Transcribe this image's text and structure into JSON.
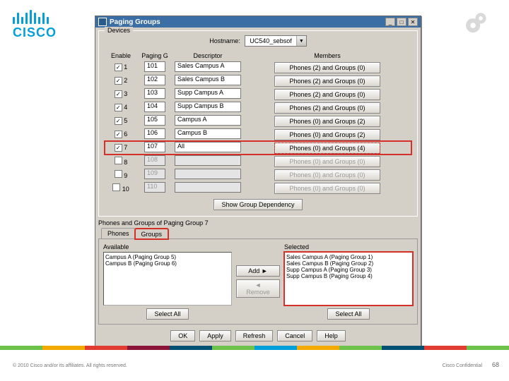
{
  "logo_text": "CISCO",
  "window": {
    "title": "Paging Groups",
    "devices_legend": "Devices",
    "hostname_label": "Hostname:",
    "hostname_value": "UC540_sebsof",
    "columns": {
      "enable": "Enable",
      "pgroup": "Paging G",
      "descriptor": "Descriptor",
      "members": "Members"
    },
    "rows": [
      {
        "enabled": true,
        "idx": "1",
        "code": "101",
        "desc": "Sales Campus A",
        "members": "Phones (2) and Groups (0)",
        "row_hl": "",
        "members_hl": ""
      },
      {
        "enabled": true,
        "idx": "2",
        "code": "102",
        "desc": "Sales Campus B",
        "members": "Phones (2) and Groups (0)",
        "row_hl": "",
        "members_hl": ""
      },
      {
        "enabled": true,
        "idx": "3",
        "code": "103",
        "desc": "Supp Campus A",
        "members": "Phones (2) and Groups (0)",
        "row_hl": "",
        "members_hl": ""
      },
      {
        "enabled": true,
        "idx": "4",
        "code": "104",
        "desc": "Supp Campus B",
        "members": "Phones (2) and Groups (0)",
        "row_hl": "",
        "members_hl": ""
      },
      {
        "enabled": true,
        "idx": "5",
        "code": "105",
        "desc": "Campus A",
        "members": "Phones (0) and Groups (2)",
        "row_hl": "",
        "members_hl": ""
      },
      {
        "enabled": true,
        "idx": "6",
        "code": "106",
        "desc": "Campus B",
        "members": "Phones (0) and Groups (2)",
        "row_hl": "",
        "members_hl": ""
      },
      {
        "enabled": true,
        "idx": "7",
        "code": "107",
        "desc": "All",
        "members": "Phones (0) and Groups (4)",
        "row_hl": "solid",
        "members_hl": "dash"
      },
      {
        "enabled": false,
        "idx": "8",
        "code": "108",
        "desc": "",
        "members": "Phones (0) and Groups (0)",
        "row_hl": "",
        "members_hl": "",
        "disabled": true
      },
      {
        "enabled": false,
        "idx": "9",
        "code": "109",
        "desc": "",
        "members": "Phones (0) and Groups (0)",
        "row_hl": "",
        "members_hl": "",
        "disabled": true
      },
      {
        "enabled": false,
        "idx": "10",
        "code": "110",
        "desc": "",
        "members": "Phones (0) and Groups (0)",
        "row_hl": "",
        "members_hl": "",
        "disabled": true
      }
    ],
    "show_dep_btn": "Show Group Dependency",
    "sub_label": "Phones and Groups of Paging Group 7",
    "tabs": {
      "phones": "Phones",
      "groups": "Groups"
    },
    "available_label": "Available",
    "available_items": [
      "Campus A (Paging Group 5)",
      "Campus B (Paging Group 6)"
    ],
    "selected_label": "Selected",
    "selected_items": [
      "Sales Campus A (Paging Group 1)",
      "Sales Campus B (Paging Group 2)",
      "Supp Campus A (Paging Group 3)",
      "Supp Campus B (Paging Group 4)"
    ],
    "add_btn": "Add ►",
    "remove_btn": "◄ Remove",
    "select_all": "Select All",
    "bottom": {
      "ok": "OK",
      "apply": "Apply",
      "refresh": "Refresh",
      "cancel": "Cancel",
      "help": "Help"
    }
  },
  "footer": {
    "copyright": "© 2010 Cisco and/or its affiliates. All rights reserved.",
    "confidential": "Cisco Confidential",
    "page": "68",
    "bar_colors": [
      "#6cc24a",
      "#f2a900",
      "#e03c31",
      "#8a1538",
      "#005073",
      "#6cc24a",
      "#009fda",
      "#f2a900",
      "#6cc24a",
      "#005073",
      "#e03c31",
      "#6cc24a"
    ]
  }
}
